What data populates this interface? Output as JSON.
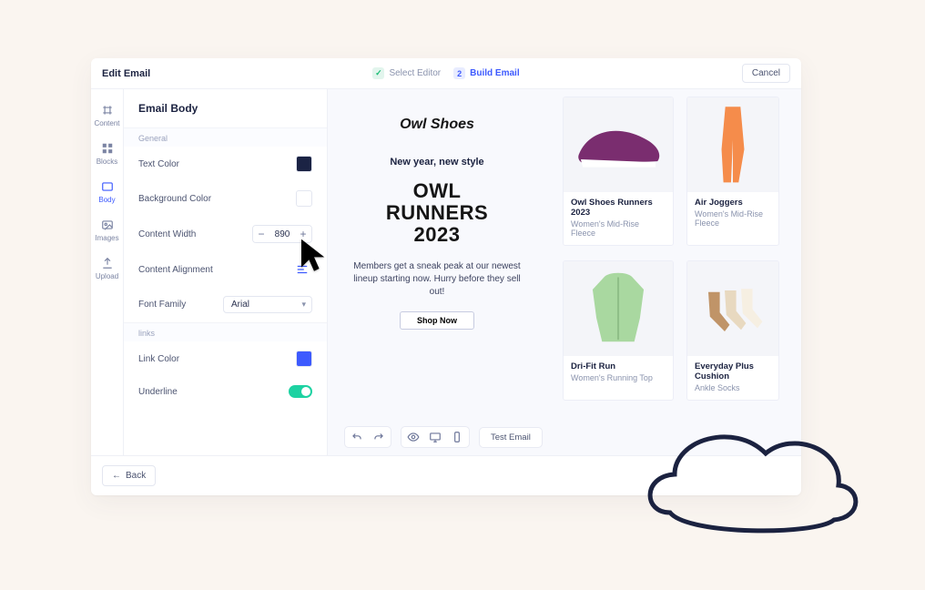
{
  "topbar": {
    "title": "Edit Email",
    "step1_label": "Select Editor",
    "step2_num": "2",
    "step2_label": "Build Email",
    "cancel_label": "Cancel"
  },
  "rail": {
    "items": [
      {
        "label": "Content"
      },
      {
        "label": "Blocks"
      },
      {
        "label": "Body"
      },
      {
        "label": "Images"
      },
      {
        "label": "Upload"
      }
    ]
  },
  "panel": {
    "title": "Email Body",
    "section_general": "General",
    "section_links": "links",
    "fields": {
      "text_color": "Text Color",
      "bg_color": "Background Color",
      "content_width": "Content Width",
      "content_width_val": "890",
      "alignment": "Content Alignment",
      "font_family": "Font Family",
      "font_family_val": "Arial",
      "link_color": "Link Color",
      "underline": "Underline"
    }
  },
  "email": {
    "brand": "Owl Shoes",
    "tagline": "New year, new style",
    "hero_l1": "OWL",
    "hero_l2": "RUNNERS",
    "hero_l3": "2023",
    "copy": "Members get a sneak peak at our newest lineup starting now. Hurry before they sell out!",
    "cta": "Shop Now"
  },
  "cards": [
    {
      "title": "Owl Shoes Runners 2023",
      "subtitle": "Women's Mid-Rise Fleece"
    },
    {
      "title": "Air Joggers",
      "subtitle": "Women's Mid-Rise Fleece"
    },
    {
      "title": "Dri-Fit Run",
      "subtitle": "Women's Running Top"
    },
    {
      "title": "Everyday Plus Cushion",
      "subtitle": "Ankle Socks"
    }
  ],
  "canvas_tb": {
    "test_label": "Test Email"
  },
  "footer": {
    "back_label": "Back"
  },
  "colors": {
    "text_color": "#1b2344",
    "bg_color": "#ffffff",
    "link_color": "#3d5afe"
  }
}
